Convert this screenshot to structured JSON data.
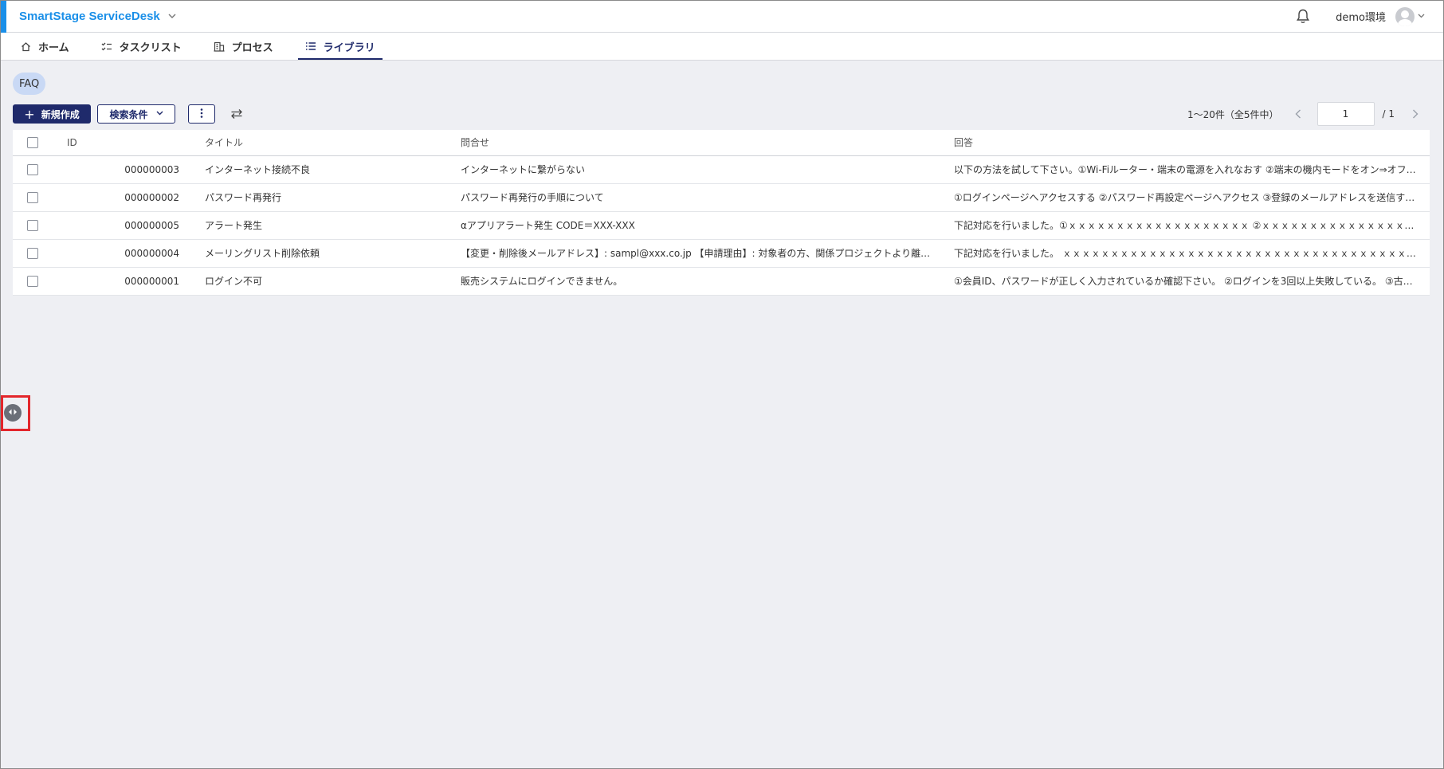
{
  "header": {
    "app_title": "SmartStage ServiceDesk",
    "env_label": "demo環境"
  },
  "nav": {
    "tabs": [
      {
        "label": "ホーム",
        "icon": "home-icon",
        "active": false
      },
      {
        "label": "タスクリスト",
        "icon": "checklist-icon",
        "active": false
      },
      {
        "label": "プロセス",
        "icon": "building-icon",
        "active": false
      },
      {
        "label": "ライブラリ",
        "icon": "list-icon",
        "active": true
      }
    ]
  },
  "page": {
    "tag": "FAQ"
  },
  "toolbar": {
    "new_label": "新規作成",
    "search_label": "検索条件",
    "more_icon": "more-vertical-icon",
    "swap_icon": "swap-icon"
  },
  "pager": {
    "range_text": "1〜20件（全5件中）",
    "current_page": "1",
    "total_text": "/ 1"
  },
  "table": {
    "columns": [
      "ID",
      "タイトル",
      "問合せ",
      "回答"
    ],
    "rows": [
      {
        "id": "000000003",
        "title": "インターネット接続不良",
        "inquiry": "インターネットに繋がらない",
        "answer": "以下の方法を試して下さい。①Wi-Fiルーター・端末の電源を入れなおす ②端末の機内モードをオン⇒オフ…"
      },
      {
        "id": "000000002",
        "title": "パスワード再発行",
        "inquiry": "パスワード再発行の手順について",
        "answer": "①ログインページへアクセスする ②パスワード再設定ページへアクセス ③登録のメールアドレスを送信す…"
      },
      {
        "id": "000000005",
        "title": "アラート発生",
        "inquiry": "αアプリアラート発生 CODE＝XXX-XXX",
        "answer": "下記対応を行いました。①ｘｘｘｘｘｘｘｘｘｘｘｘｘｘｘｘｘｘｘ ②ｘｘｘｘｘｘｘｘｘｘｘｘｘｘｘｘｘｘｘ…"
      },
      {
        "id": "000000004",
        "title": "メーリングリスト削除依頼",
        "inquiry": "【変更・削除後メールアドレス】: sampl@xxx.co.jp 【申請理由】: 対象者の方、関係プロジェクトより離…",
        "answer": "下記対応を行いました。 ｘｘｘｘｘｘｘｘｘｘｘｘｘｘｘｘｘｘｘｘｘｘｘｘｘｘｘｘｘｘｘｘｘｘｘｘｘｘ…"
      },
      {
        "id": "000000001",
        "title": "ログイン不可",
        "inquiry": "販売システムにログインできません。",
        "answer": "①会員ID、パスワードが正しく入力されているか確認下さい。 ②ログインを3回以上失敗している。 ③古い…"
      }
    ]
  },
  "colors": {
    "brand": "#1a8fe8",
    "primary": "#1f2a6b",
    "highlight": "#e3262b",
    "background": "#eeeff3"
  }
}
